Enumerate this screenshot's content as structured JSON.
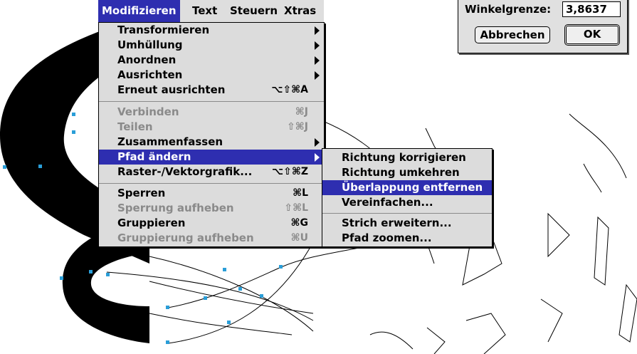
{
  "menubar": {
    "items": [
      "Modifizieren",
      "Text",
      "Steuern",
      "Xtras"
    ],
    "active_index": 0
  },
  "modify_menu": {
    "items": [
      {
        "label": "Transformieren",
        "shortcut": "",
        "submenu": true,
        "enabled": true
      },
      {
        "label": "Umhüllung",
        "shortcut": "",
        "submenu": true,
        "enabled": true
      },
      {
        "label": "Anordnen",
        "shortcut": "",
        "submenu": true,
        "enabled": true
      },
      {
        "label": "Ausrichten",
        "shortcut": "",
        "submenu": true,
        "enabled": true
      },
      {
        "label": "Erneut ausrichten",
        "shortcut": "⌥⇧⌘A",
        "submenu": false,
        "enabled": true
      },
      {
        "label": "Verbinden",
        "shortcut": "⌘J",
        "submenu": false,
        "enabled": false
      },
      {
        "label": "Teilen",
        "shortcut": "⇧⌘J",
        "submenu": false,
        "enabled": false
      },
      {
        "label": "Zusammenfassen",
        "shortcut": "",
        "submenu": true,
        "enabled": true
      },
      {
        "label": "Pfad ändern",
        "shortcut": "",
        "submenu": true,
        "enabled": true,
        "selected": true
      },
      {
        "label": "Raster-/Vektorgrafik...",
        "shortcut": "⌥⇧⌘Z",
        "submenu": false,
        "enabled": true
      },
      {
        "label": "Sperren",
        "shortcut": "⌘L",
        "submenu": false,
        "enabled": true
      },
      {
        "label": "Sperrung aufheben",
        "shortcut": "⇧⌘L",
        "submenu": false,
        "enabled": false
      },
      {
        "label": "Gruppieren",
        "shortcut": "⌘G",
        "submenu": false,
        "enabled": true
      },
      {
        "label": "Gruppierung aufheben",
        "shortcut": "⌘U",
        "submenu": false,
        "enabled": false
      }
    ]
  },
  "path_submenu": {
    "items": [
      {
        "label": "Richtung korrigieren",
        "selected": false
      },
      {
        "label": "Richtung umkehren",
        "selected": false
      },
      {
        "label": "Überlappung entfernen",
        "selected": true
      },
      {
        "label": "Vereinfachen...",
        "selected": false
      },
      {
        "label": "Strich erweitern...",
        "selected": false
      },
      {
        "label": "Pfad zoomen...",
        "selected": false
      }
    ]
  },
  "dialog": {
    "label": "Winkelgrenze:",
    "value": "3,8637",
    "cancel_label": "Abbrechen",
    "ok_label": "OK"
  },
  "colors": {
    "menu_highlight": "#2e2eb0",
    "menu_background": "#dcdcdc",
    "disabled_text": "#8a8a8a",
    "path_point": "#2a9ed8"
  }
}
